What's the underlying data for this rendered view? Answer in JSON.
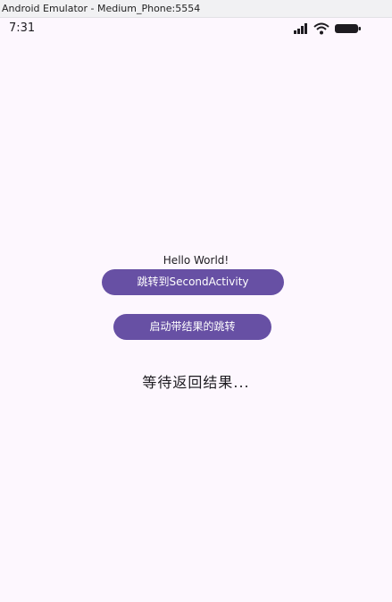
{
  "window": {
    "title": "Android Emulator - Medium_Phone:5554"
  },
  "status_bar": {
    "time": "7:31",
    "icons": [
      "signal-icon",
      "wifi-icon",
      "battery-icon"
    ]
  },
  "main": {
    "hello_text": "Hello World!",
    "button_second_activity": "跳转到SecondActivity",
    "button_start_for_result": "启动带结果的跳转",
    "result_text": "等待返回结果..."
  },
  "colors": {
    "background": "#fdf7fe",
    "button": "#6750a4",
    "button_text": "#ffffff",
    "text": "#1d1b20"
  }
}
